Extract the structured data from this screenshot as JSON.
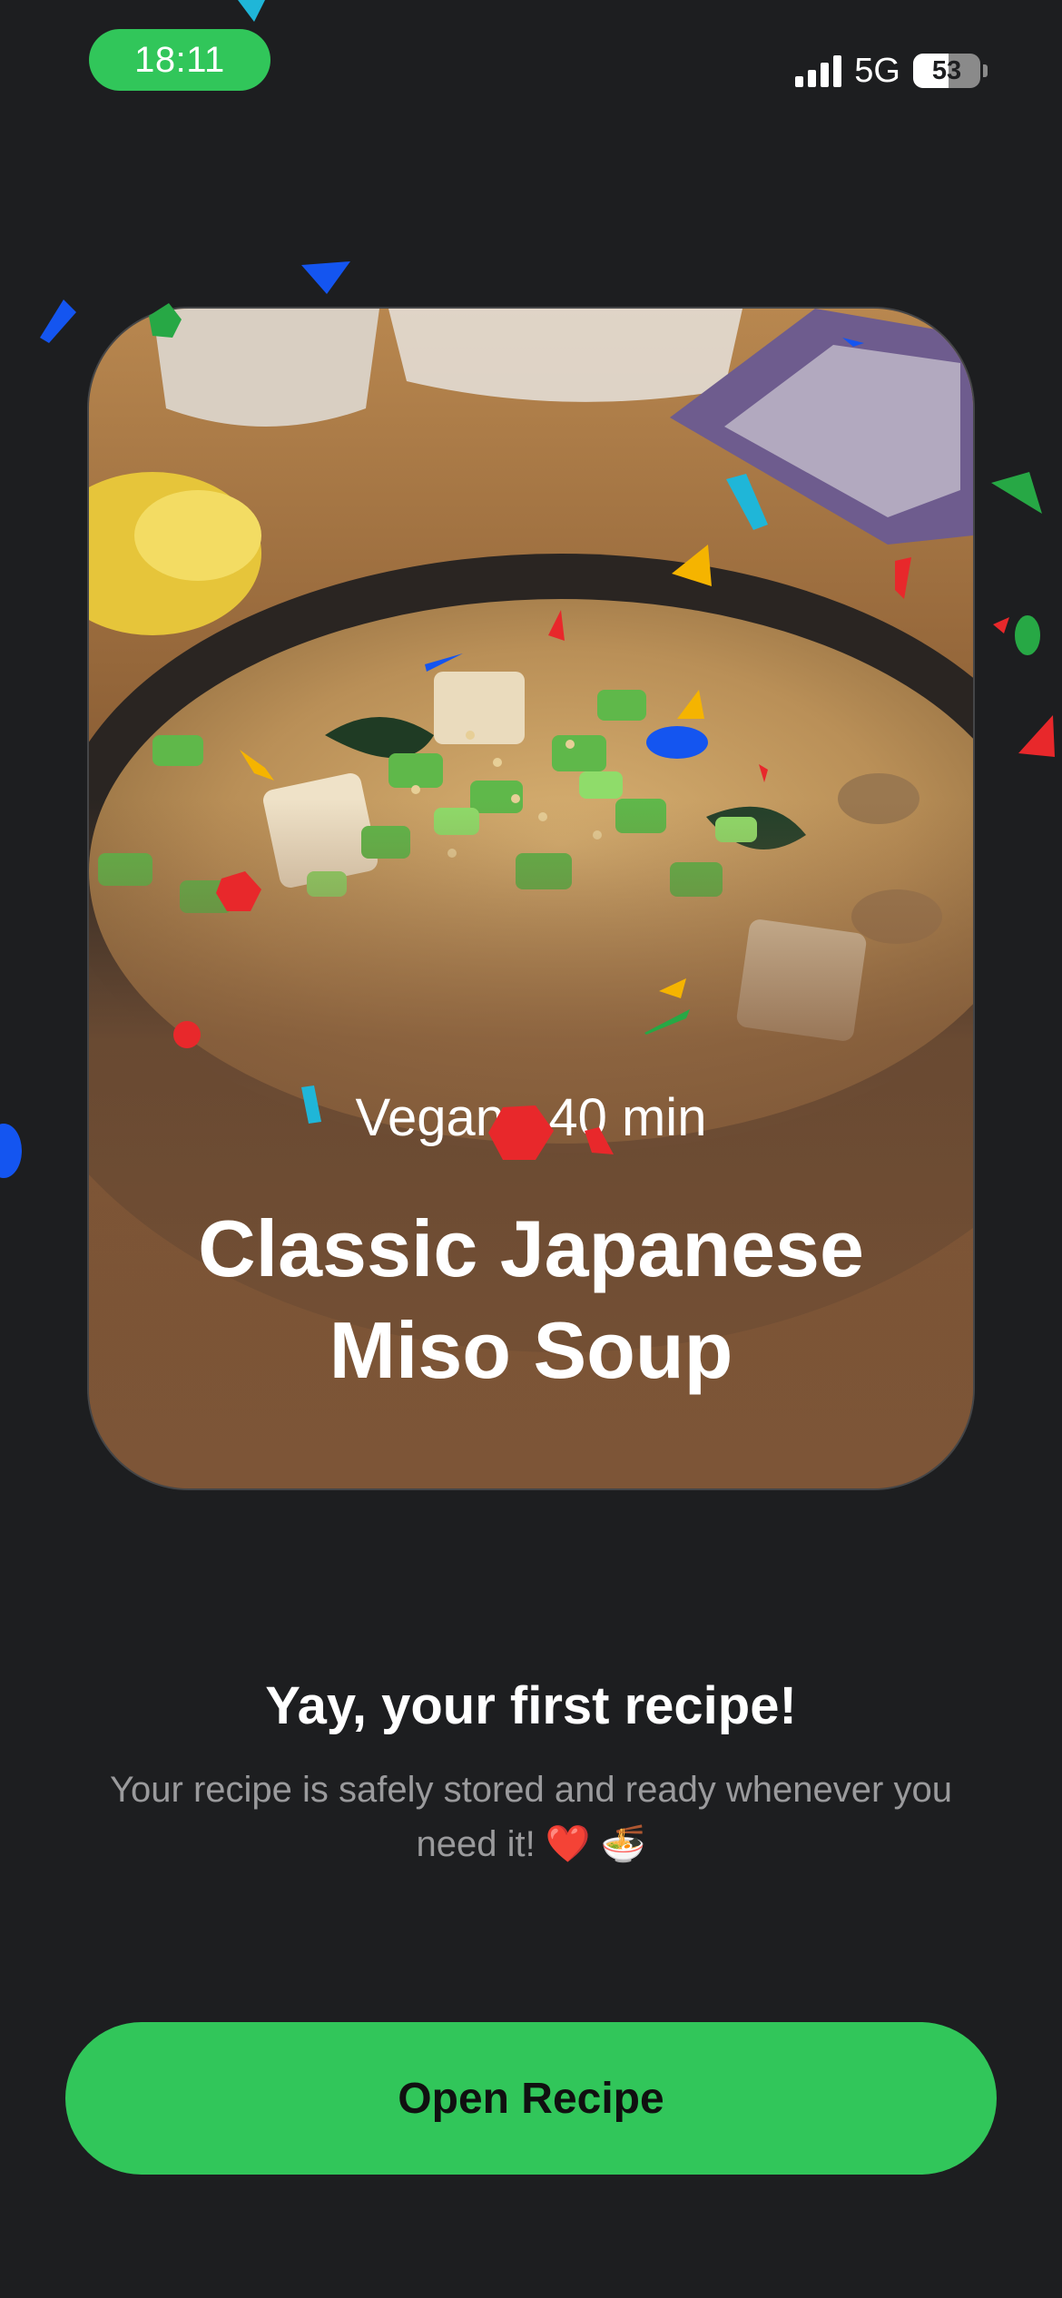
{
  "status_bar": {
    "time": "18:11",
    "network": "5G",
    "battery_level": "53"
  },
  "recipe": {
    "diet": "Vegan",
    "separator": "•",
    "duration": "40 min",
    "title": "Classic Japanese Miso Soup"
  },
  "message": {
    "heading": "Yay, your first recipe!",
    "body": "Your recipe is safely stored and ready whenever you need it! ❤️ 🍜"
  },
  "actions": {
    "open_label": "Open Recipe"
  },
  "colors": {
    "background": "#1d1e20",
    "accent": "#31c65a",
    "muted_text": "#9a9a9c"
  }
}
